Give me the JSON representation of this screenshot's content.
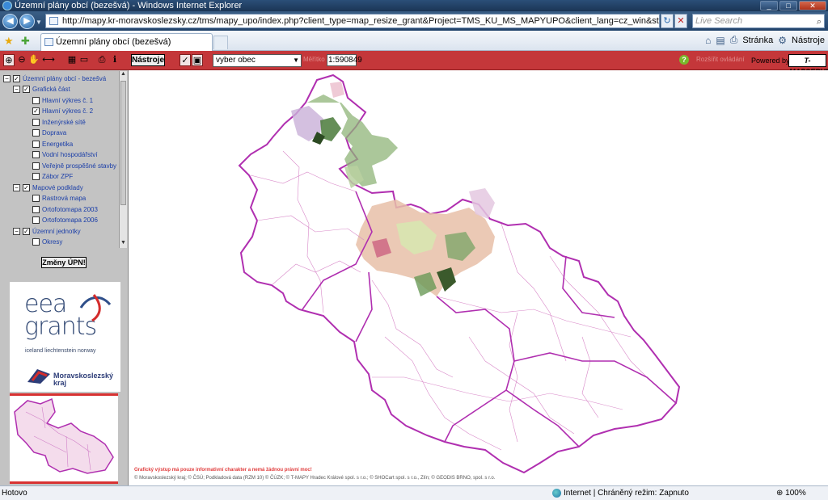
{
  "window": {
    "title": "Územní plány obcí (bezešvá) - Windows Internet Explorer"
  },
  "address": {
    "url": "http://mapy.kr-moravskoslezsky.cz/tms/mapy_upo/index.php?client_type=map_resize_grant&Project=TMS_KU_MS_MAPYUPO&client_lang=cz_win&strange_opener=0&interface=tmv&Theme",
    "search_placeholder": "Live Search"
  },
  "tabs": {
    "active_label": "Územní plány obcí (bezešvá)"
  },
  "commandbar": {
    "page_label": "Stránka",
    "tools_label": "Nástroje"
  },
  "app_toolbar": {
    "tools_button": "Nástroje",
    "municipality_select": "vyber obec",
    "scale_label": "Měřítko",
    "scale_value": "1:590849",
    "help_label": "Rozšířit ovládání",
    "powered_by": "Powered by",
    "brand": "T-MAPSERVER"
  },
  "layer_tree": [
    {
      "label": "Územní plány obcí - bezešvá",
      "checked": true,
      "expander": true,
      "indent": 0
    },
    {
      "label": "Grafická část",
      "checked": true,
      "expander": true,
      "indent": 1
    },
    {
      "label": "Hlavní výkres č. 1",
      "checked": false,
      "expander": false,
      "indent": 2
    },
    {
      "label": "Hlavní výkres č. 2",
      "checked": true,
      "expander": false,
      "indent": 2
    },
    {
      "label": "Inženýrské sítě",
      "checked": false,
      "expander": false,
      "indent": 2
    },
    {
      "label": "Doprava",
      "checked": false,
      "expander": false,
      "indent": 2
    },
    {
      "label": "Energetika",
      "checked": false,
      "expander": false,
      "indent": 2
    },
    {
      "label": "Vodní hospodářství",
      "checked": false,
      "expander": false,
      "indent": 2
    },
    {
      "label": "Veřejně prospěšné stavby",
      "checked": false,
      "expander": false,
      "indent": 2
    },
    {
      "label": "Zábor ZPF",
      "checked": false,
      "expander": false,
      "indent": 2
    },
    {
      "label": "Mapové podklady",
      "checked": true,
      "expander": true,
      "indent": 1
    },
    {
      "label": "Rastrová mapa",
      "checked": false,
      "expander": false,
      "indent": 2
    },
    {
      "label": "Ortofotomapa 2003",
      "checked": false,
      "expander": false,
      "indent": 2
    },
    {
      "label": "Ortofotomapa 2006",
      "checked": false,
      "expander": false,
      "indent": 2
    },
    {
      "label": "Územní jednotky",
      "checked": true,
      "expander": true,
      "indent": 1
    },
    {
      "label": "Okresy",
      "checked": false,
      "expander": false,
      "indent": 2
    }
  ],
  "left_panel": {
    "changes_button": "Změny ÚPN!",
    "logo_main": "eea grants",
    "logo_sub": "iceland liechtenstein norway",
    "region_logo": "Moravskoslezský kraj"
  },
  "map": {
    "disclaimer": "Grafický výstup má pouze informativní charakter a nemá žádnou právní moc!",
    "credits": "© Moravskoslezský kraj; © ČSÚ; Podkladová data (RZM 10) © ČÚZK; © T-MAPY Hradec Králové spol. s r.o.; © SHOCart spol. s r.o., Zlín; © GEODIS BRNO, spol. s r.o.",
    "boundary_color": "#b02fb0",
    "fill_colors": [
      "#7fa66a",
      "#c9a8d6",
      "#f2c8a8",
      "#d8e6b0",
      "#e8b4c4",
      "#4a7a3a"
    ]
  },
  "statusbar": {
    "status": "Hotovo",
    "zone": "Internet | Chráněný režim: Zapnuto",
    "zoom": "100%"
  }
}
